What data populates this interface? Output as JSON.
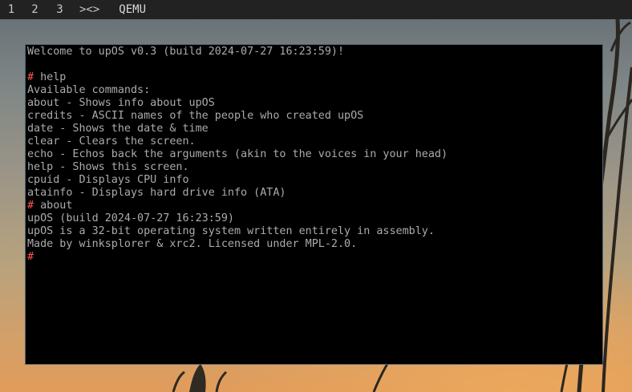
{
  "topbar": {
    "workspaces": [
      "1",
      "2",
      "3"
    ],
    "layout_indicator": "><>",
    "window_title": "QEMU"
  },
  "terminal": {
    "prompt_symbol": "#",
    "lines": [
      {
        "prompt": false,
        "text": "Welcome to upOS v0.3 (build 2024-07-27 16:23:59)!"
      },
      {
        "prompt": false,
        "text": ""
      },
      {
        "prompt": true,
        "text": " help"
      },
      {
        "prompt": false,
        "text": "Available commands:"
      },
      {
        "prompt": false,
        "text": "about - Shows info about upOS"
      },
      {
        "prompt": false,
        "text": "credits - ASCII names of the people who created upOS"
      },
      {
        "prompt": false,
        "text": "date - Shows the date & time"
      },
      {
        "prompt": false,
        "text": "clear - Clears the screen."
      },
      {
        "prompt": false,
        "text": "echo - Echos back the arguments (akin to the voices in your head)"
      },
      {
        "prompt": false,
        "text": "help - Shows this screen."
      },
      {
        "prompt": false,
        "text": "cpuid - Displays CPU info"
      },
      {
        "prompt": false,
        "text": "atainfo - Displays hard drive info (ATA)"
      },
      {
        "prompt": true,
        "text": " about"
      },
      {
        "prompt": false,
        "text": "upOS (build 2024-07-27 16:23:59)"
      },
      {
        "prompt": false,
        "text": "upOS is a 32-bit operating system written entirely in assembly."
      },
      {
        "prompt": false,
        "text": "Made by winksplorer & xrc2. Licensed under MPL-2.0."
      },
      {
        "prompt": true,
        "text": ""
      }
    ]
  },
  "colors": {
    "topbar_bg": "#222222",
    "terminal_bg": "#000000",
    "terminal_text": "#ababab",
    "prompt": "#ff5555",
    "window_border": "#4d6575"
  }
}
